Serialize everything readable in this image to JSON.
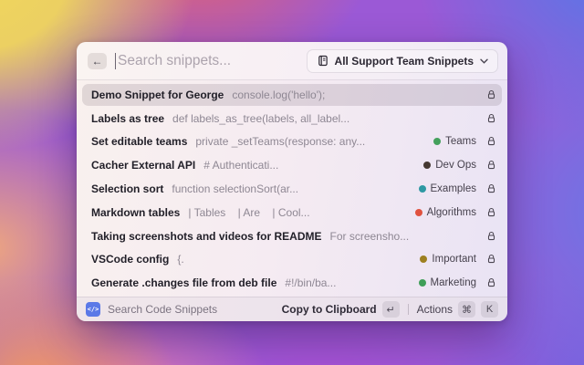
{
  "search": {
    "back_icon": "←",
    "placeholder": "Search snippets...",
    "filter_dropdown": {
      "label": "All Support Team Snippets"
    }
  },
  "list": {
    "rows": [
      {
        "title": "Demo Snippet for George",
        "code": "console.log('hello');",
        "selected": true
      },
      {
        "title": "Labels as tree",
        "code": "def labels_as_tree(labels, all_label..."
      },
      {
        "title": "Set editable teams",
        "code": "private _setTeams(response: any...",
        "tag": {
          "label": "Teams",
          "color": "#44a05c"
        }
      },
      {
        "title": "Cacher External API",
        "code": "# Authenticati...",
        "tag": {
          "label": "Dev Ops",
          "color": "#453831"
        }
      },
      {
        "title": "Selection sort",
        "code": "function selectionSort(ar...",
        "tag": {
          "label": "Examples",
          "color": "#2f99a3"
        }
      },
      {
        "title": "Markdown tables",
        "code": "| Tables    | Are    | Cool...",
        "tag": {
          "label": "Algorithms",
          "color": "#e0523f"
        }
      },
      {
        "title": "Taking screenshots and videos for README",
        "code": "For screensho..."
      },
      {
        "title": "VSCode config",
        "code": "{.",
        "tag": {
          "label": "Important",
          "color": "#9d8020"
        }
      },
      {
        "title": "Generate .changes file from deb file",
        "code": "#!/bin/ba...",
        "tag": {
          "label": "Marketing",
          "color": "#3f9e58"
        }
      }
    ]
  },
  "footer": {
    "app_icon": {
      "glyph": "</>",
      "color": "#5b79e7"
    },
    "app_name": "Search Code Snippets",
    "primary_action": {
      "label": "Copy to Clipboard",
      "key": "↵"
    },
    "secondary_action": {
      "label": "Actions",
      "keys": [
        "⌘",
        "K"
      ]
    }
  }
}
